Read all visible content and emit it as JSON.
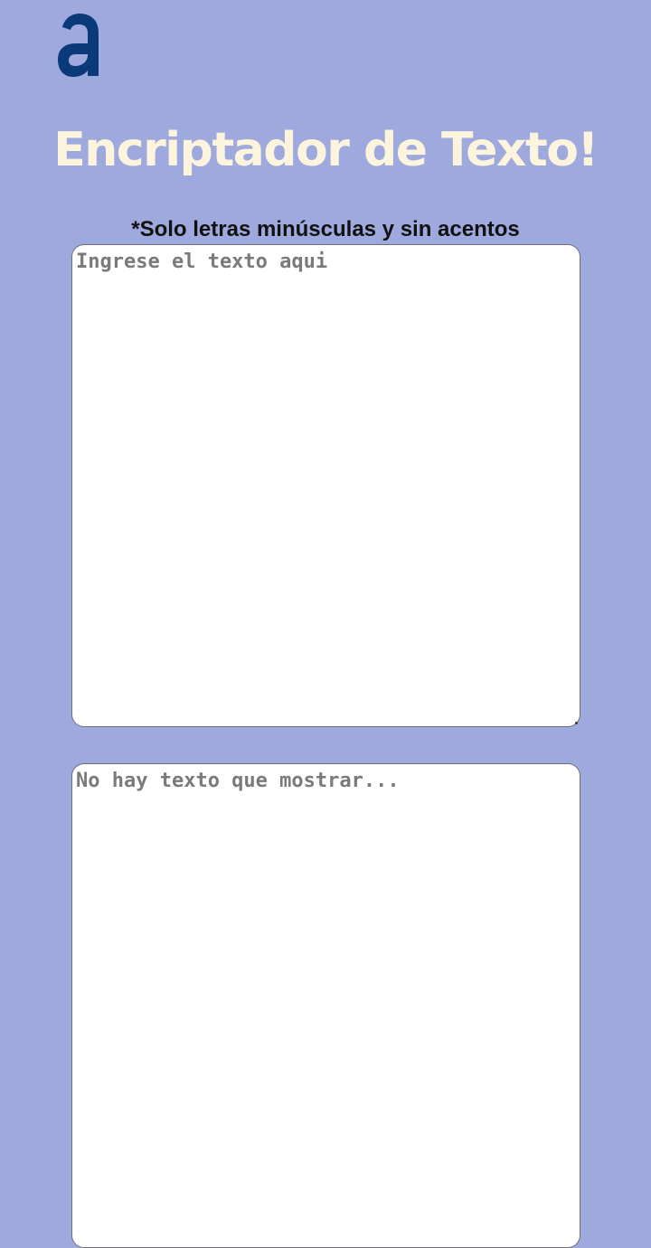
{
  "header": {
    "logo_icon": "alura-logo-icon",
    "logo_color": "#0a3a7a",
    "title": "Encriptador de Texto!",
    "title_color": "#fcf4dc"
  },
  "input": {
    "note": "*Solo letras minúsculas y sin acentos",
    "placeholder": "Ingrese el texto aqui",
    "value": ""
  },
  "output": {
    "placeholder": "No hay texto que mostrar...",
    "value": ""
  },
  "theme": {
    "background": "#9ea9dd",
    "panel": "#ffffff"
  }
}
